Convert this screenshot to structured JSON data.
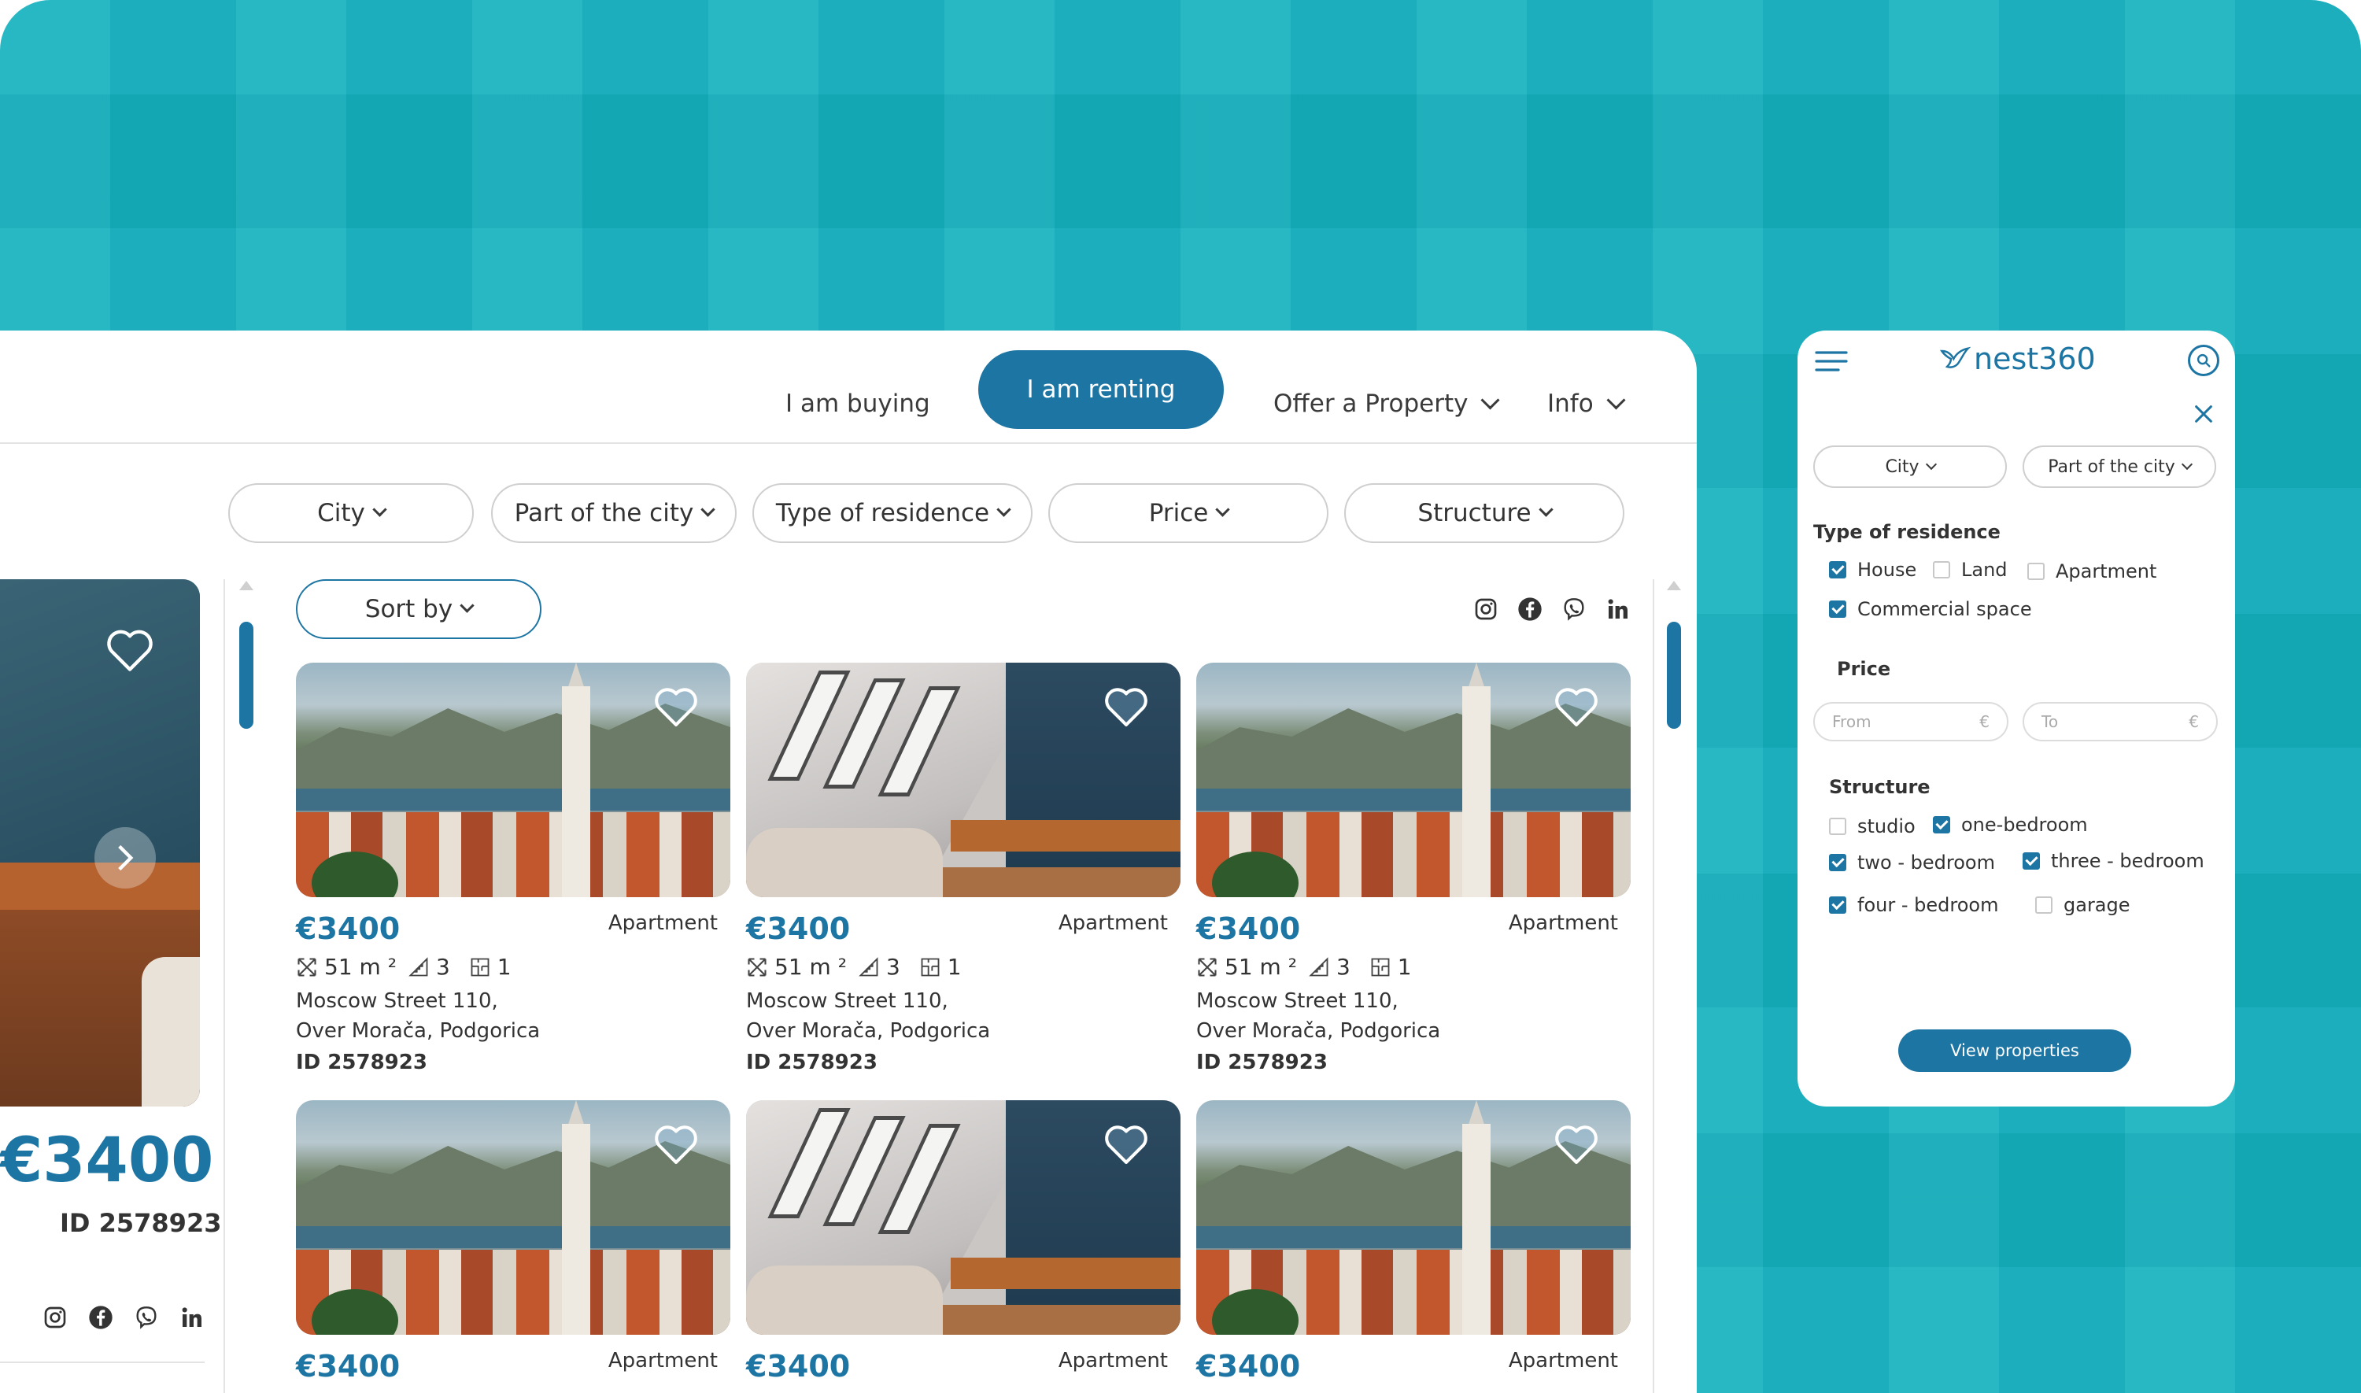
{
  "nav": {
    "buying": "I am buying",
    "renting": "I am renting",
    "offer": "Offer a Property",
    "info": "Info"
  },
  "filters": {
    "city": "City",
    "part": "Part of the city",
    "type": "Type of residence",
    "price": "Price",
    "structure": "Structure"
  },
  "sort": "Sort by",
  "featured": {
    "price": "€3400",
    "id": "ID 2578923"
  },
  "cards": [
    {
      "price": "€3400",
      "type": "Apartment",
      "area": "51 m ²",
      "rooms": "3",
      "baths": "1",
      "addr1": "Moscow Street 110,",
      "addr2": "Over Morača, Podgorica",
      "id": "ID 2578923",
      "scene": "city"
    },
    {
      "price": "€3400",
      "type": "Apartment",
      "area": "51 m ²",
      "rooms": "3",
      "baths": "1",
      "addr1": "Moscow Street 110,",
      "addr2": "Over Morača, Podgorica",
      "id": "ID 2578923",
      "scene": "room"
    },
    {
      "price": "€3400",
      "type": "Apartment",
      "area": "51 m ²",
      "rooms": "3",
      "baths": "1",
      "addr1": "Moscow Street 110,",
      "addr2": "Over Morača, Podgorica",
      "id": "ID 2578923",
      "scene": "city"
    },
    {
      "price": "€3400",
      "type": "Apartment",
      "scene": "city"
    },
    {
      "price": "€3400",
      "type": "Apartment",
      "scene": "room"
    },
    {
      "price": "€3400",
      "type": "Apartment",
      "scene": "city"
    }
  ],
  "mobile": {
    "logo": "nest360",
    "city": "City",
    "part": "Part of the city",
    "type_title": "Type of residence",
    "types": [
      {
        "label": "House",
        "checked": true
      },
      {
        "label": "Land",
        "checked": false
      },
      {
        "label": "Apartment",
        "checked": false
      },
      {
        "label": "Commercial space",
        "checked": true
      }
    ],
    "price_title": "Price",
    "from_placeholder": "From",
    "to_placeholder": "To",
    "currency": "€",
    "structure_title": "Structure",
    "structures": [
      {
        "label": "studio",
        "checked": false
      },
      {
        "label": "one-bedroom",
        "checked": true
      },
      {
        "label": "two - bedroom",
        "checked": true
      },
      {
        "label": "three - bedroom",
        "checked": true
      },
      {
        "label": "four - bedroom",
        "checked": true
      },
      {
        "label": "garage",
        "checked": false
      }
    ],
    "view_button": "View properties"
  },
  "colors": {
    "accent": "#1d75a3",
    "teal": "#14b1bf"
  }
}
